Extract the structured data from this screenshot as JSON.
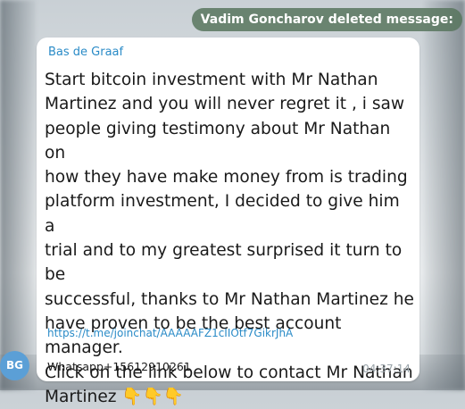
{
  "service_message": {
    "text": "Vadim Goncharov deleted message:"
  },
  "message": {
    "sender": "Bas de Graaf",
    "avatar_initials": "BG",
    "text": "Start bitcoin investment with Mr Nathan\nMartinez and you will never regret it , i saw\npeople giving testimony about Mr Nathan on\nhow they have make money from is trading\nplatform  investment, I decided to give him a\ntrial  and to my greatest surprised it turn to be\nsuccessful, thanks to Mr Nathan Martinez he\nhave proven to be the best account manager.\nClick on the link below to contact Mr Nathan\nMartinez 👇👇👇",
    "link": "https://t.me/joinchat/AAAAAFZ1cIIOtf7GikrJhA",
    "whatsapp": "Whatsapp+15612910261",
    "time": "04:37:14"
  },
  "colors": {
    "sender_name": "#2a8bc7",
    "link": "#2a8bc7",
    "avatar_bg": "#5b9fd6",
    "service_pill_bg": "#58765e",
    "bubble_bg": "#ffffff"
  }
}
